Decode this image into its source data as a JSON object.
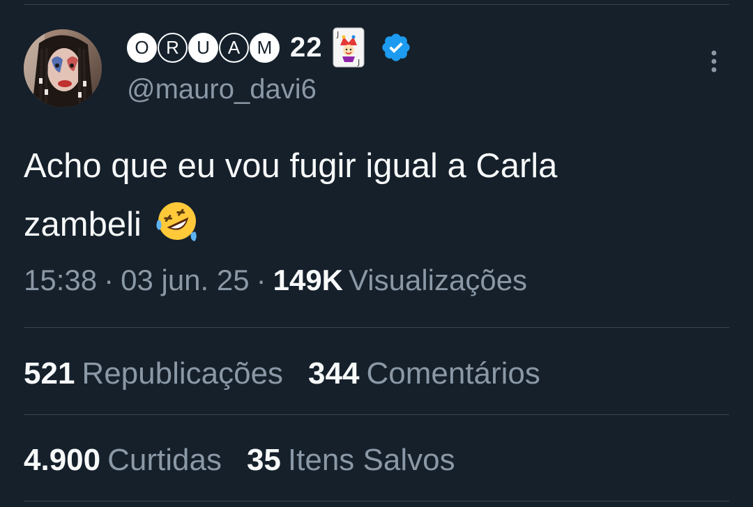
{
  "header": {
    "name_letters": [
      "O",
      "R",
      "U",
      "A",
      "M"
    ],
    "name_suffix": "22",
    "handle": "@mauro_davi6",
    "icons": {
      "joker": "joker-card-icon",
      "verified": "verified-badge-icon",
      "more": "more-options-icon"
    }
  },
  "tweet": {
    "text_line1": "Acho que eu vou fugir igual a Carla",
    "text_line2": "zambeli",
    "emoji": "rolling-on-floor-laughing-emoji"
  },
  "meta": {
    "time": "15:38",
    "separator": "·",
    "date": "03 jun. 25",
    "views_count": "149K",
    "views_label": "Visualizações"
  },
  "stats": {
    "reposts_count": "521",
    "reposts_label": "Republicações",
    "comments_count": "344",
    "comments_label": "Comentários",
    "likes_count": "4.900",
    "likes_label": "Curtidas",
    "saves_count": "35",
    "saves_label": "Itens Salvos"
  },
  "colors": {
    "background": "#15202b",
    "text_primary": "#f7f9f9",
    "text_secondary": "#8b98a5",
    "divider": "#38444d",
    "verified": "#1d9bf0"
  }
}
